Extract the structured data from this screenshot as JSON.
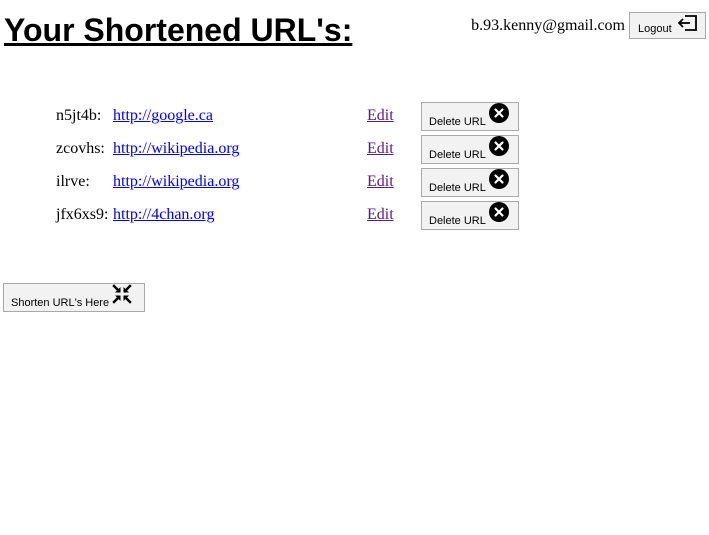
{
  "header": {
    "title": "Your Shortened URL's:",
    "user_email": "b.93.kenny@gmail.com",
    "logout_label": "Logout"
  },
  "urls": [
    {
      "code": "n5jt4b:",
      "url": "http://google.ca",
      "edit_label": "Edit",
      "delete_label": "Delete URL"
    },
    {
      "code": "zcovhs:",
      "url": "http://wikipedia.org",
      "edit_label": "Edit",
      "delete_label": "Delete URL"
    },
    {
      "code": "ilrve:",
      "url": "http://wikipedia.org",
      "edit_label": "Edit",
      "delete_label": "Delete URL"
    },
    {
      "code": "jfx6xs9:",
      "url": "http://4chan.org",
      "edit_label": "Edit",
      "delete_label": "Delete URL"
    }
  ],
  "actions": {
    "shorten_label": "Shorten URL's Here"
  },
  "icons": {
    "logout": "logout-icon",
    "delete": "close-circle-icon",
    "shorten": "compress-arrows-icon"
  },
  "colors": {
    "link": "#0000ee",
    "visited_link": "#551a8b",
    "button_bg": "#f2f2f2",
    "button_border": "#a9a9a9"
  }
}
